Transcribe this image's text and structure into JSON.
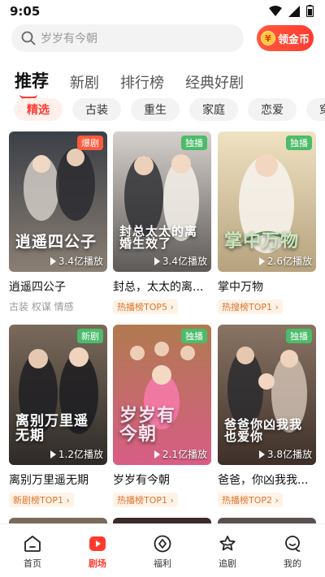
{
  "status": {
    "time": "9:05"
  },
  "search": {
    "placeholder": "岁岁有今朝",
    "coin_label": "领金币",
    "coin_glyph": "¥"
  },
  "tabs": [
    {
      "label": "推荐",
      "active": true
    },
    {
      "label": "新剧"
    },
    {
      "label": "排行榜"
    },
    {
      "label": "经典好剧"
    }
  ],
  "chips": [
    {
      "label": "精选",
      "active": true
    },
    {
      "label": "古装"
    },
    {
      "label": "重生"
    },
    {
      "label": "家庭"
    },
    {
      "label": "恋爱"
    },
    {
      "label": "穿越"
    }
  ],
  "cards": [
    {
      "title": "逍遥四公子",
      "poster_text": "逍遥四公子",
      "badge": "爆剧",
      "badge_color": "#ff5a3c",
      "plays": "3.4亿播放",
      "sub": "古装 权谋 情感",
      "rank": "",
      "colors": [
        "#3b3f47",
        "#8a7f74"
      ]
    },
    {
      "title": "封总，太太的离...",
      "poster_text": "封总太太的离婚生效了",
      "badge": "独播",
      "badge_color": "#4cbb6a",
      "plays": "3.4亿播放",
      "sub": "",
      "rank": "热播榜TOP5",
      "colors": [
        "#c9c4c1",
        "#5e5a57"
      ]
    },
    {
      "title": "掌中万物",
      "poster_text": "掌中万物",
      "badge": "独播",
      "badge_color": "#4cbb6a",
      "plays": "2.6亿播放",
      "sub": "",
      "rank": "热搜榜TOP1",
      "colors": [
        "#e9d7b0",
        "#b6a27e"
      ]
    },
    {
      "title": "离别万里遥无期",
      "poster_text": "离别万里遥无期",
      "badge": "新剧",
      "badge_color": "#4cbb6a",
      "plays": "1.2亿播放",
      "sub": "",
      "rank": "新剧榜TOP1",
      "colors": [
        "#6b5a4a",
        "#2e2a28"
      ]
    },
    {
      "title": "岁岁有今朝",
      "poster_text": "岁岁有今朝",
      "badge": "独播",
      "badge_color": "#4cbb6a",
      "plays": "2.1亿播放",
      "sub": "",
      "rank": "热播榜TOP1",
      "colors": [
        "#b57f54",
        "#d85d86"
      ]
    },
    {
      "title": "爸爸，你凶我我...",
      "poster_text": "爸爸你凶我我也爱你",
      "badge": "独播",
      "badge_color": "#4cbb6a",
      "plays": "3.8亿播放",
      "sub": "",
      "rank": "热播榜TOP2",
      "colors": [
        "#7a6555",
        "#3d2f28"
      ]
    }
  ],
  "nav": [
    {
      "label": "首页",
      "icon": "home-icon"
    },
    {
      "label": "剧场",
      "icon": "theater-icon",
      "active": true
    },
    {
      "label": "福利",
      "icon": "benefit-icon"
    },
    {
      "label": "追剧",
      "icon": "follow-icon"
    },
    {
      "label": "我的",
      "icon": "profile-icon"
    }
  ]
}
